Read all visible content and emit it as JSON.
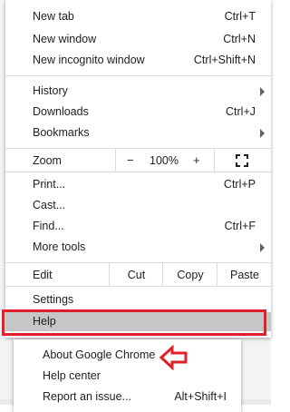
{
  "menu": {
    "group1": [
      {
        "label": "New tab",
        "shortcut": "Ctrl+T"
      },
      {
        "label": "New window",
        "shortcut": "Ctrl+N"
      },
      {
        "label": "New incognito window",
        "shortcut": "Ctrl+Shift+N"
      }
    ],
    "group2": [
      {
        "label": "History",
        "shortcut": ""
      },
      {
        "label": "Downloads",
        "shortcut": "Ctrl+J"
      },
      {
        "label": "Bookmarks",
        "shortcut": ""
      }
    ],
    "zoom": {
      "label": "Zoom",
      "minus": "−",
      "value": "100%",
      "plus": "+",
      "fullscreen_icon": "fullscreen-icon"
    },
    "group3": [
      {
        "label": "Print...",
        "shortcut": "Ctrl+P"
      },
      {
        "label": "Cast...",
        "shortcut": ""
      },
      {
        "label": "Find...",
        "shortcut": "Ctrl+F"
      },
      {
        "label": "More tools",
        "shortcut": ""
      }
    ],
    "edit": {
      "label": "Edit",
      "cut": "Cut",
      "copy": "Copy",
      "paste": "Paste"
    },
    "settings": "Settings",
    "help": "Help"
  },
  "help_submenu": [
    {
      "label": "About Google Chrome",
      "shortcut": ""
    },
    {
      "label": "Help center",
      "shortcut": ""
    },
    {
      "label": "Report an issue...",
      "shortcut": "Alt+Shift+I"
    }
  ],
  "colors": {
    "highlight_outline": "#e0202b",
    "selected_row": "#c6c6c6"
  }
}
